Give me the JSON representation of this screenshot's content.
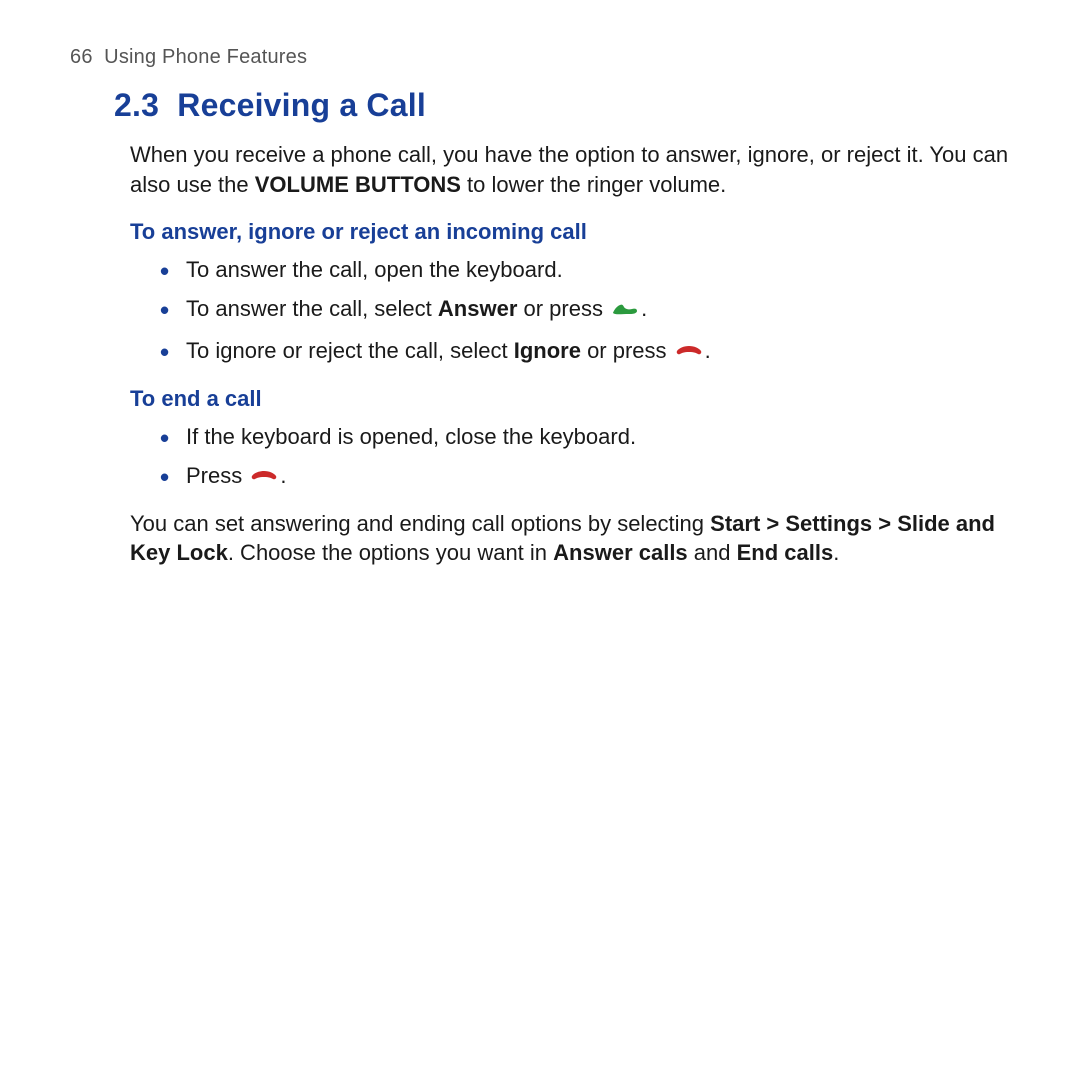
{
  "header": {
    "page_number": "66",
    "chapter": "Using Phone Features"
  },
  "section": {
    "number": "2.3",
    "title": "Receiving a Call"
  },
  "intro": {
    "line1_pre": "When you receive a phone call, you have the option to answer, ignore, or reject it. You can also use the ",
    "vol_buttons": "VOLUME BUTTONS",
    "line1_post": " to lower the ringer volume."
  },
  "sub1": {
    "heading": "To answer, ignore or reject an incoming call",
    "items": {
      "b1": "To answer the call, open the keyboard.",
      "b2_pre": "To answer the call, select ",
      "b2_answer": "Answer",
      "b2_mid": " or press ",
      "b2_post": ".",
      "b3_pre": "To ignore or reject the call, select ",
      "b3_ignore": "Ignore",
      "b3_mid": " or press ",
      "b3_post": "."
    }
  },
  "sub2": {
    "heading": "To end a call",
    "items": {
      "b1": "If the keyboard is opened, close the keyboard.",
      "b2_pre": "Press ",
      "b2_post": "."
    }
  },
  "footer": {
    "pre": "You can set answering and ending call options by selecting ",
    "path": "Start > Settings > Slide and Key Lock",
    "mid": ". Choose the options you want in ",
    "answer_calls": "Answer calls",
    "and": " and ",
    "end_calls": "End calls",
    "post": "."
  },
  "colors": {
    "heading_blue": "#183f97",
    "talk_green": "#2b9a3e",
    "end_red": "#cc2a2a"
  }
}
